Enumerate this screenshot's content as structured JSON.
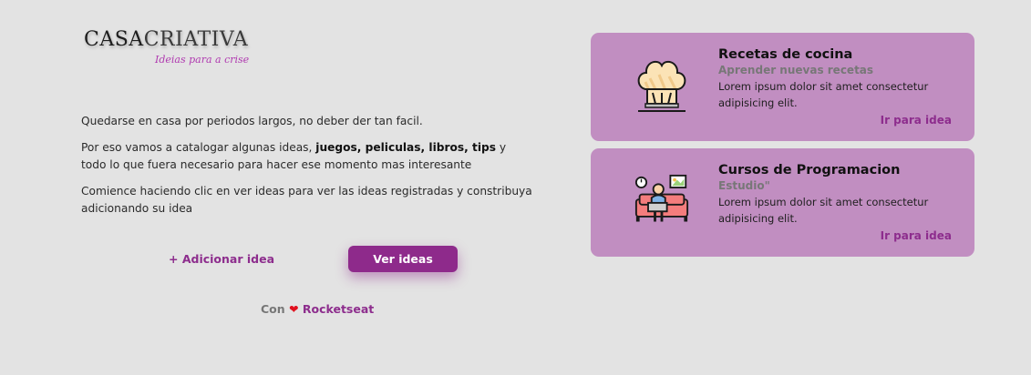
{
  "logo": {
    "bold": "CASA",
    "light": "CRIATIVA",
    "tagline": "Ideias para a crise"
  },
  "intro": {
    "p1": "Quedarse en casa por periodos largos, no deber der tan facil.",
    "p2_before": "Por eso vamos a catalogar algunas ideas, ",
    "p2_strong": "juegos, peliculas, libros, tips",
    "p2_after": " y todo lo que fuera necesario para hacer ese momento mas interesante",
    "p3": "Comience haciendo clic en ver ideas para ver las ideas registradas y constribuya adicionando su idea"
  },
  "actions": {
    "add_label": "+ Adicionar idea",
    "view_label": "Ver ideas"
  },
  "footer": {
    "prefix": "Con",
    "heart": "❤",
    "brand": "Rocketseat"
  },
  "cards": [
    {
      "title": "Recetas de cocina",
      "category": "Aprender nuevas recetas",
      "description": "Lorem ipsum dolor sit amet consectetur adipisicing elit.",
      "link": "Ir para idea",
      "icon": "chef-hat-icon"
    },
    {
      "title": "Cursos de Programacion",
      "category": "Estudio\"",
      "description": "Lorem ipsum dolor sit amet consectetur adipisicing elit.",
      "link": "Ir para idea",
      "icon": "person-on-sofa-laptop-icon"
    }
  ],
  "colors": {
    "accent": "#8e2a8b",
    "card_bg": "#c18ec1",
    "page_bg": "#e3e3e3",
    "heart": "#e0101e"
  }
}
